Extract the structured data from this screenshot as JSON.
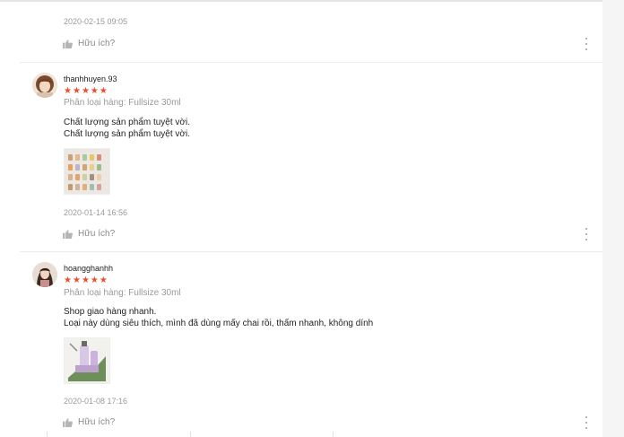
{
  "reviews": [
    {
      "timestamp": "2020-02-15 09:05",
      "helpful_label": "Hữu ích?"
    },
    {
      "username": "thanhhuyen.93",
      "rating": 5,
      "variant": "Phân loại hàng: Fullsize 30ml",
      "comment_lines": [
        "Chất lượng sản phẩm tuyệt vời.",
        "Chất lượng sản phẩm tuyệt vời."
      ],
      "timestamp": "2020-01-14 16:56",
      "helpful_label": "Hữu ích?"
    },
    {
      "username": "hoangghanhh",
      "rating": 5,
      "variant": "Phân loại hàng: Fullsize 30ml",
      "comment_lines": [
        "Shop giao hàng nhanh.",
        "Loại này dùng siêu thích, mình đã dùng mấy chai rồi, thấm nhanh, không dính"
      ],
      "timestamp": "2020-01-08 17:16",
      "helpful_label": "Hữu ích?"
    }
  ],
  "colors": {
    "star": "#ee4d2d",
    "muted": "#9a9a9a"
  },
  "icons": {
    "helpful": "thumbs-up-icon",
    "more": "more-vertical-icon"
  }
}
